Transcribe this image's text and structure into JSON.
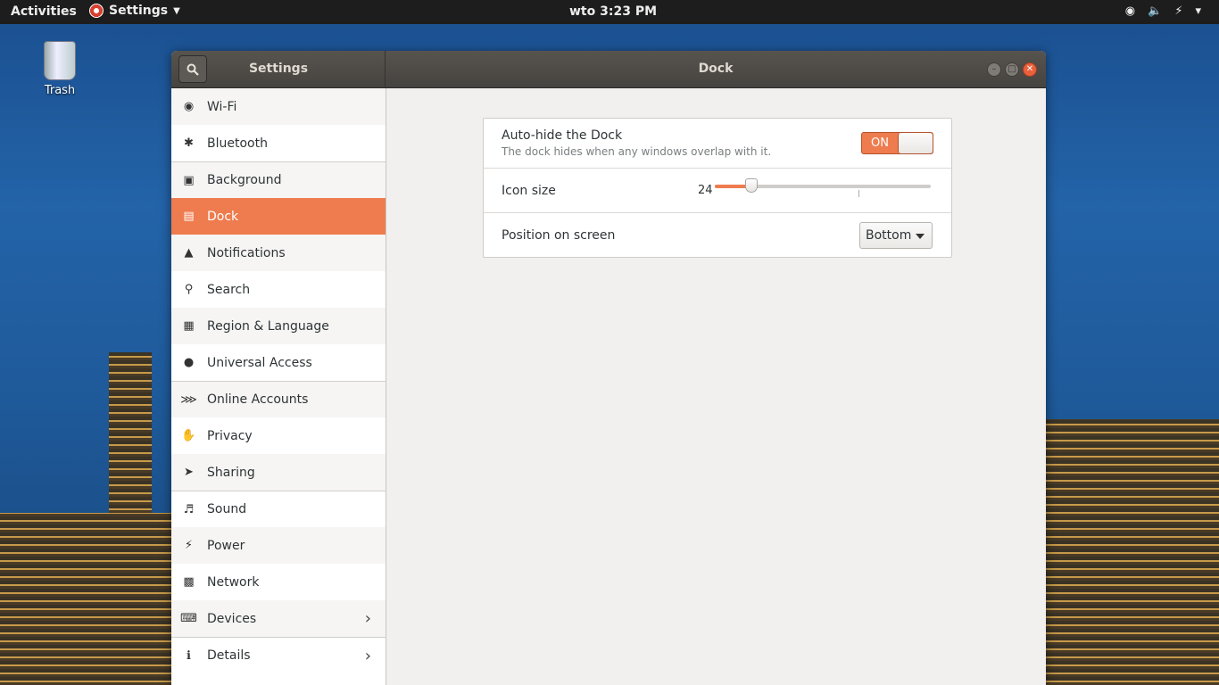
{
  "topbar": {
    "activities": "Activities",
    "app_menu": "Settings",
    "clock": "wto  3:23 PM",
    "tray_icons": [
      "wifi-icon",
      "volume-muted-icon",
      "battery-charging-icon",
      "power-menu-icon"
    ]
  },
  "desktop": {
    "trash_label": "Trash"
  },
  "window": {
    "sidebar_title": "Settings",
    "panel_title": "Dock",
    "accent": "#ee7c4e"
  },
  "sidebar": {
    "items": [
      {
        "label": "Wi-Fi",
        "icon": "wifi-icon"
      },
      {
        "label": "Bluetooth",
        "icon": "bluetooth-icon"
      },
      {
        "label": "Background",
        "icon": "background-icon"
      },
      {
        "label": "Dock",
        "icon": "dock-icon",
        "active": true
      },
      {
        "label": "Notifications",
        "icon": "bell-icon"
      },
      {
        "label": "Search",
        "icon": "search-icon"
      },
      {
        "label": "Region & Language",
        "icon": "camera-icon"
      },
      {
        "label": "Universal Access",
        "icon": "accessibility-icon"
      },
      {
        "label": "Online Accounts",
        "icon": "online-accounts-icon"
      },
      {
        "label": "Privacy",
        "icon": "hand-icon"
      },
      {
        "label": "Sharing",
        "icon": "share-icon"
      },
      {
        "label": "Sound",
        "icon": "speaker-icon"
      },
      {
        "label": "Power",
        "icon": "power-icon"
      },
      {
        "label": "Network",
        "icon": "network-icon"
      },
      {
        "label": "Devices",
        "icon": "devices-icon"
      },
      {
        "label": "Details",
        "icon": "info-icon"
      }
    ]
  },
  "dock": {
    "autohide_label": "Auto-hide the Dock",
    "autohide_desc": "The dock hides when any windows overlap with it.",
    "autohide_state": "ON",
    "icon_size_label": "Icon size",
    "icon_size_value": "24",
    "icon_size_fraction": 0.17,
    "position_label": "Position on screen",
    "position_value": "Bottom"
  }
}
